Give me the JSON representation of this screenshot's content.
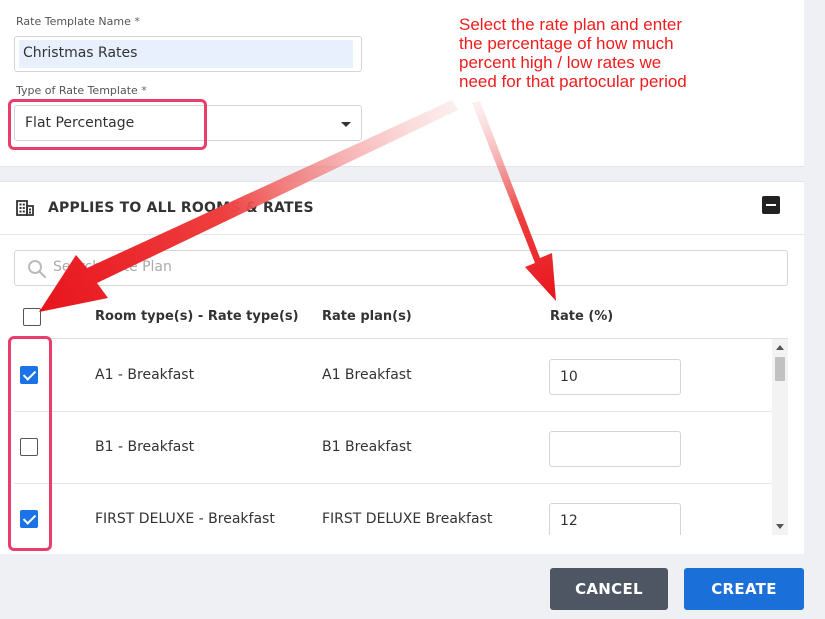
{
  "form": {
    "name_label": "Rate Template Name",
    "name_required": "*",
    "name_value": "Christmas Rates",
    "type_label": "Type of Rate Template",
    "type_required": "*",
    "type_value": "Flat Percentage"
  },
  "section": {
    "title": "APPLIES TO ALL ROOMS & RATES",
    "icon": "building-icon",
    "collapse_icon": "minus-square-icon"
  },
  "search": {
    "placeholder": "Search Rate Plan",
    "icon": "search-icon"
  },
  "table": {
    "headers": {
      "room_rate_type": "Room type(s) - Rate type(s)",
      "rate_plan": "Rate plan(s)",
      "rate": "Rate (%)"
    },
    "select_all_checked": false,
    "rows": [
      {
        "room_rate_type": "A1 - Breakfast",
        "rate_plan": "A1 Breakfast",
        "rate": "10",
        "checked": true
      },
      {
        "room_rate_type": "B1 - Breakfast",
        "rate_plan": "B1 Breakfast",
        "rate": "",
        "checked": false
      },
      {
        "room_rate_type": "FIRST DELUXE - Breakfast",
        "rate_plan": "FIRST DELUXE Breakfast",
        "rate": "12",
        "checked": true
      }
    ]
  },
  "buttons": {
    "cancel": "CANCEL",
    "create": "CREATE"
  },
  "annotation": {
    "lines": [
      "Select the rate plan and enter",
      "the percentage of how much",
      "percent high / low rates we",
      "need for that partocular period"
    ],
    "color": "#ee1c1c",
    "highlight_color": "#e83e6c"
  },
  "colors": {
    "primary": "#1a6fd8",
    "secondary": "#4e5663",
    "checkbox": "#1a73e8",
    "input_autofill": "#e8f0fe"
  }
}
